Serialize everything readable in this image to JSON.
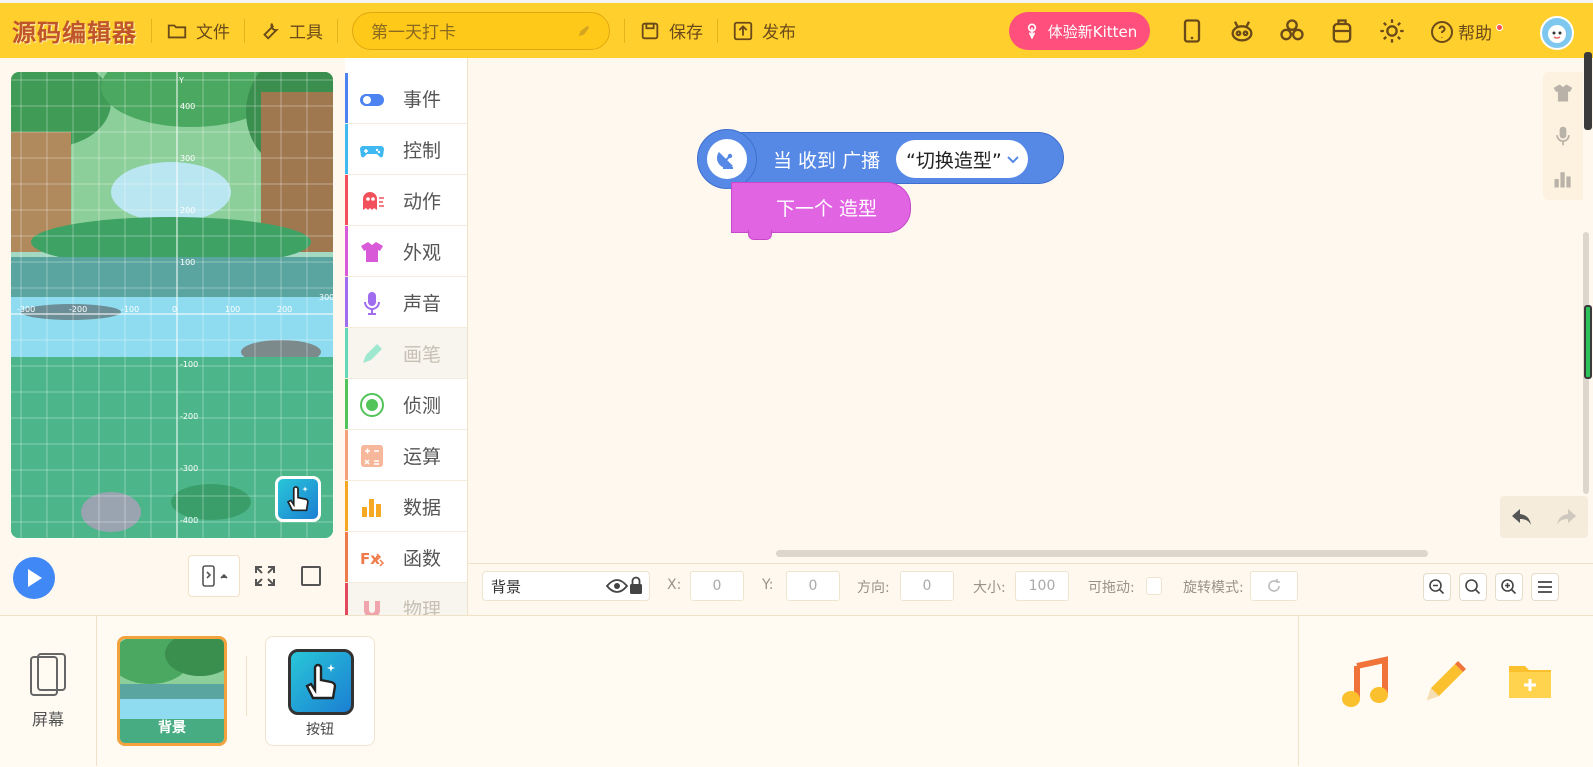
{
  "app": {
    "logo": "源码编辑器"
  },
  "topbar": {
    "file_label": "文件",
    "tools_label": "工具",
    "project_name": "第一天打卡",
    "save_label": "保存",
    "publish_label": "发布",
    "kitten_label": "体验新Kitten",
    "help_label": "帮助"
  },
  "categories": [
    {
      "label": "事件",
      "color": "#4c83f0",
      "icon": "toggle-icon"
    },
    {
      "label": "控制",
      "color": "#40b8f2",
      "icon": "gamepad-icon"
    },
    {
      "label": "动作",
      "color": "#f2515b",
      "icon": "ghost-icon"
    },
    {
      "label": "外观",
      "color": "#d95ad9",
      "icon": "shirt-icon"
    },
    {
      "label": "声音",
      "color": "#a06cf0",
      "icon": "microphone-icon"
    },
    {
      "label": "画笔",
      "color": "#63d8b8",
      "icon": "pen-icon"
    },
    {
      "label": "侦测",
      "color": "#52c45a",
      "icon": "radar-icon"
    },
    {
      "label": "运算",
      "color": "#f6a07a",
      "icon": "calculator-icon"
    },
    {
      "label": "数据",
      "color": "#f7a823",
      "icon": "bar-chart-icon"
    },
    {
      "label": "函数",
      "color": "#f07b4a",
      "icon": "function-icon"
    },
    {
      "label": "物理",
      "color": "#e04a5a",
      "icon": "magnet-icon"
    }
  ],
  "blocks": {
    "hat_text": "当 收到 广播",
    "hat_dropdown": "“切换造型”",
    "command_text": "下一个 造型"
  },
  "properties": {
    "name": "背景",
    "x_label": "X:",
    "x_value": "0",
    "y_label": "Y:",
    "y_value": "0",
    "direction_label": "方向:",
    "direction_value": "0",
    "size_label": "大小:",
    "size_value": "100",
    "draggable_label": "可拖动:",
    "rotation_label": "旋转模式:"
  },
  "stage": {
    "x_ticks": [
      "-300",
      "-200",
      "-100",
      "0",
      "100",
      "200",
      "300"
    ],
    "y_ticks": [
      "400",
      "300",
      "200",
      "100",
      "-100",
      "-200",
      "-300",
      "-400"
    ],
    "y_axis_label": "Y"
  },
  "bottom": {
    "screen_label": "屏幕",
    "sprites": [
      {
        "label": "背景",
        "selected": true
      },
      {
        "label": "按钮",
        "selected": false
      }
    ]
  },
  "colors": {
    "topbar": "#ffd02d",
    "kitten": "#ff4f7c",
    "hat_block": "#5689e6",
    "command_block": "#e165e3",
    "play": "#3f88f5"
  }
}
